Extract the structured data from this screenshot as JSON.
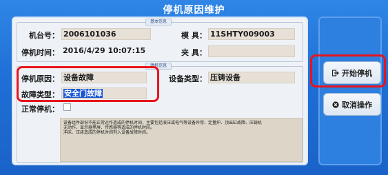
{
  "title": "停机原因维护",
  "basic_group": {
    "legend": "基本信息",
    "machine_label": "机台号：",
    "machine_value": "2006101036",
    "mold_label": "模 具：",
    "mold_value": "11SHTY009003",
    "stop_time_label": "停机时间：",
    "stop_time_value": "2016/4/29 10:07:15",
    "fixture_label": "夹 具：",
    "fixture_value": ""
  },
  "stop_group": {
    "legend": "停机信息",
    "reason_label": "停机原因：",
    "reason_value": "设备故障",
    "equipment_type_label": "设备类型：",
    "equipment_type_value": "压铸设备",
    "fault_type_label": "故障类型：",
    "fault_type_value": "安全门故障",
    "normal_stop_label": "正常停机：",
    "normal_stop_checked": false
  },
  "note": {
    "lines": [
      "设备组件部份不能正常运作造成的停机时间，主要包括液压或电气等设备异常、定量炉、顶出缸故障、压铸机",
      "无动作、显示器黑屏、传感器等造成的停机时间。",
      "冲床、压床造成的停机时间列入设备故障时间。"
    ]
  },
  "buttons": {
    "start_label": "开始停机",
    "start_icon": "exit-arrow-icon",
    "cancel_label": "取消操作",
    "cancel_icon": "close-circle-icon"
  },
  "colors": {
    "window_blue": "#1f6fd6",
    "highlight_red": "#e8141c",
    "selection_blue": "#1a56d6"
  }
}
